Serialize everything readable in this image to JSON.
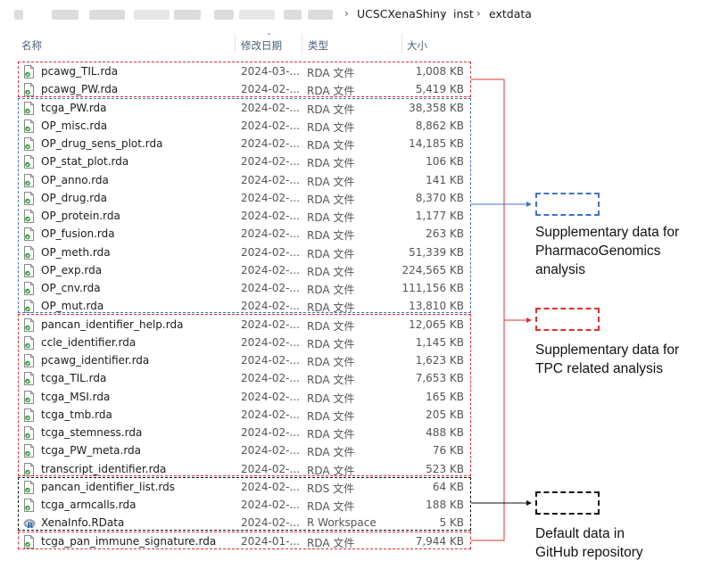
{
  "breadcrumb": {
    "items": [
      "UCSCXenaShiny",
      "inst",
      "extdata"
    ],
    "separator": "›"
  },
  "columns": {
    "name": "名称",
    "date": "修改日期",
    "type": "类型",
    "size": "大小"
  },
  "files": [
    {
      "name": "pcawg_TIL.rda",
      "date": "2024-03-...",
      "type": "RDA 文件",
      "size": "1,008 KB",
      "icon": "rda-file-icon"
    },
    {
      "name": "pcawg_PW.rda",
      "date": "2024-02-...",
      "type": "RDA 文件",
      "size": "5,419 KB",
      "icon": "rda-file-icon"
    },
    {
      "name": "tcga_PW.rda",
      "date": "2024-02-...",
      "type": "RDA 文件",
      "size": "38,358 KB",
      "icon": "rda-file-icon"
    },
    {
      "name": "OP_misc.rda",
      "date": "2024-02-...",
      "type": "RDA 文件",
      "size": "8,862 KB",
      "icon": "rda-file-icon"
    },
    {
      "name": "OP_drug_sens_plot.rda",
      "date": "2024-02-...",
      "type": "RDA 文件",
      "size": "14,185 KB",
      "icon": "rda-file-icon"
    },
    {
      "name": "OP_stat_plot.rda",
      "date": "2024-02-...",
      "type": "RDA 文件",
      "size": "106 KB",
      "icon": "rda-file-icon"
    },
    {
      "name": "OP_anno.rda",
      "date": "2024-02-...",
      "type": "RDA 文件",
      "size": "141 KB",
      "icon": "rda-file-icon"
    },
    {
      "name": "OP_drug.rda",
      "date": "2024-02-...",
      "type": "RDA 文件",
      "size": "8,370 KB",
      "icon": "rda-file-icon"
    },
    {
      "name": "OP_protein.rda",
      "date": "2024-02-...",
      "type": "RDA 文件",
      "size": "1,177 KB",
      "icon": "rda-file-icon"
    },
    {
      "name": "OP_fusion.rda",
      "date": "2024-02-...",
      "type": "RDA 文件",
      "size": "263 KB",
      "icon": "rda-file-icon"
    },
    {
      "name": "OP_meth.rda",
      "date": "2024-02-...",
      "type": "RDA 文件",
      "size": "51,339 KB",
      "icon": "rda-file-icon"
    },
    {
      "name": "OP_exp.rda",
      "date": "2024-02-...",
      "type": "RDA 文件",
      "size": "224,565 KB",
      "icon": "rda-file-icon"
    },
    {
      "name": "OP_cnv.rda",
      "date": "2024-02-...",
      "type": "RDA 文件",
      "size": "111,156 KB",
      "icon": "rda-file-icon"
    },
    {
      "name": "OP_mut.rda",
      "date": "2024-02-...",
      "type": "RDA 文件",
      "size": "13,810 KB",
      "icon": "rda-file-icon"
    },
    {
      "name": "pancan_identifier_help.rda",
      "date": "2024-02-...",
      "type": "RDA 文件",
      "size": "12,065 KB",
      "icon": "rda-file-icon"
    },
    {
      "name": "ccle_identifier.rda",
      "date": "2024-02-...",
      "type": "RDA 文件",
      "size": "1,145 KB",
      "icon": "rda-file-icon"
    },
    {
      "name": "pcawg_identifier.rda",
      "date": "2024-02-...",
      "type": "RDA 文件",
      "size": "1,623 KB",
      "icon": "rda-file-icon"
    },
    {
      "name": "tcga_TIL.rda",
      "date": "2024-02-...",
      "type": "RDA 文件",
      "size": "7,653 KB",
      "icon": "rda-file-icon"
    },
    {
      "name": "tcga_MSI.rda",
      "date": "2024-02-...",
      "type": "RDA 文件",
      "size": "165 KB",
      "icon": "rda-file-icon"
    },
    {
      "name": "tcga_tmb.rda",
      "date": "2024-02-...",
      "type": "RDA 文件",
      "size": "205 KB",
      "icon": "rda-file-icon"
    },
    {
      "name": "tcga_stemness.rda",
      "date": "2024-02-...",
      "type": "RDA 文件",
      "size": "488 KB",
      "icon": "rda-file-icon"
    },
    {
      "name": "tcga_PW_meta.rda",
      "date": "2024-02-...",
      "type": "RDA 文件",
      "size": "76 KB",
      "icon": "rda-file-icon"
    },
    {
      "name": "transcript_identifier.rda",
      "date": "2024-02-...",
      "type": "RDA 文件",
      "size": "523 KB",
      "icon": "rda-file-icon"
    },
    {
      "name": "pancan_identifier_list.rds",
      "date": "2024-02-...",
      "type": "RDS 文件",
      "size": "64 KB",
      "icon": "rds-file-icon"
    },
    {
      "name": "tcga_armcalls.rda",
      "date": "2024-02-...",
      "type": "RDA 文件",
      "size": "188 KB",
      "icon": "rda-file-icon"
    },
    {
      "name": "XenaInfo.RData",
      "date": "2024-02-...",
      "type": "R Workspace",
      "size": "5 KB",
      "icon": "r-workspace-icon"
    },
    {
      "name": "tcga_pan_immune_signature.rda",
      "date": "2024-01-...",
      "type": "RDA 文件",
      "size": "7,944 KB",
      "icon": "rda-file-icon"
    }
  ],
  "legend": [
    {
      "color": "#4472c4",
      "text_lines": [
        "Supplementary data for",
        "PharmacoGenomics",
        "analysis"
      ]
    },
    {
      "color": "#e03030",
      "text_lines": [
        "Supplementary data for",
        "TPC related analysis"
      ]
    },
    {
      "color": "#111111",
      "text_lines": [
        "Default data in",
        "GitHub repository"
      ]
    }
  ],
  "colors": {
    "blue": "#4472c4",
    "red": "#e03030",
    "black": "#111111"
  }
}
